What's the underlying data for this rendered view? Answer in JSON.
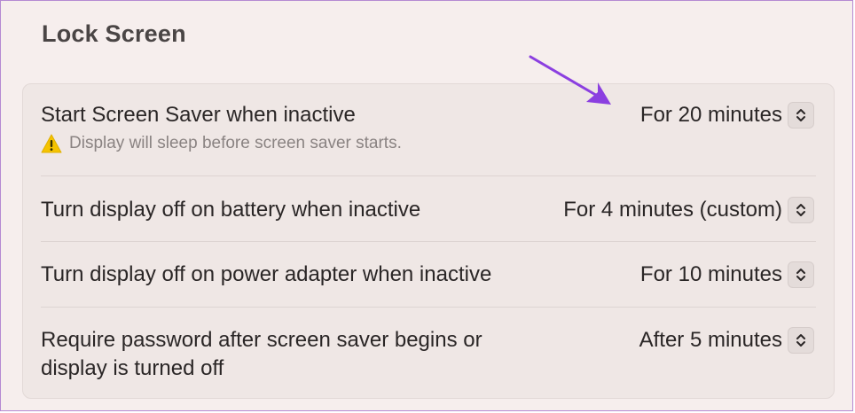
{
  "section": {
    "title": "Lock Screen"
  },
  "rows": [
    {
      "label": "Start Screen Saver when inactive",
      "warning": "Display will sleep before screen saver starts.",
      "value": "For 20 minutes"
    },
    {
      "label": "Turn display off on battery when inactive",
      "value": "For 4 minutes (custom)"
    },
    {
      "label": "Turn display off on power adapter when inactive",
      "value": "For 10 minutes"
    },
    {
      "label_line1": "Require password after screen saver begins or",
      "label_line2": "display is turned off",
      "value": "After 5 minutes"
    }
  ],
  "colors": {
    "accent_arrow": "#8b3fe0",
    "warning": "#f5c300"
  },
  "icons": {
    "warning": "warning-triangle-icon",
    "stepper": "up-down-chevron-icon",
    "annotation": "annotation-arrow-icon"
  }
}
